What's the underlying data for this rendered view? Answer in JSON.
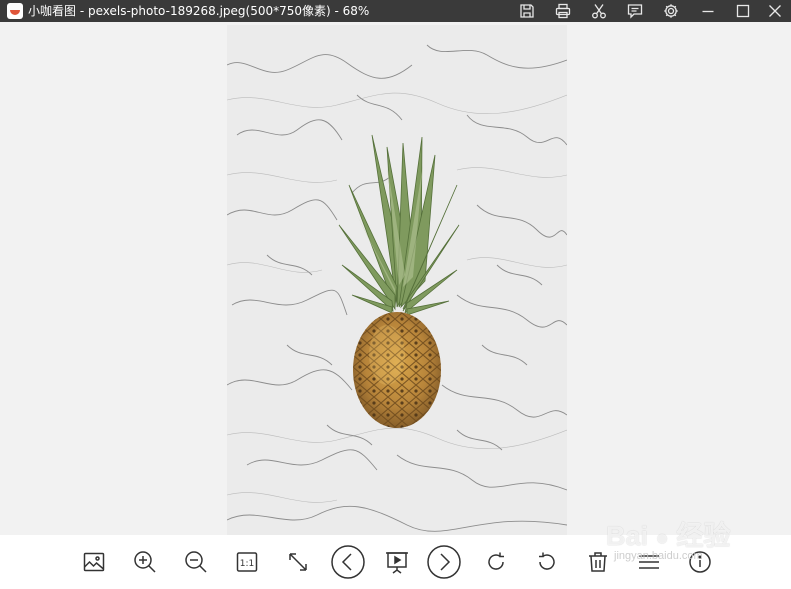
{
  "window": {
    "title": "小咖看图 - pexels-photo-189268.jpeg(500*750像素) - 68%"
  },
  "titlebar_icons": [
    "save-icon",
    "print-icon",
    "cut-icon",
    "comment-icon",
    "settings-icon",
    "minimize-icon",
    "maximize-icon",
    "close-icon"
  ],
  "toolbar": [
    "open-image-icon",
    "zoom-in-icon",
    "zoom-out-icon",
    "actual-size-icon",
    "fit-window-icon",
    "previous-icon",
    "slideshow-icon",
    "next-icon",
    "rotate-right-icon",
    "rotate-left-icon",
    "delete-icon",
    "menu-icon",
    "info-icon"
  ],
  "toolbar_actual_size_label": "1:1",
  "watermark": {
    "text": "Bai",
    "text2": "经验",
    "sub": "jingyan.baidu.com"
  },
  "colors": {
    "titlebar_bg": "#3a3a3a",
    "viewer_bg": "#f2f2f2",
    "toolbar_bg": "#ffffff",
    "icon_stroke": "#333333"
  }
}
